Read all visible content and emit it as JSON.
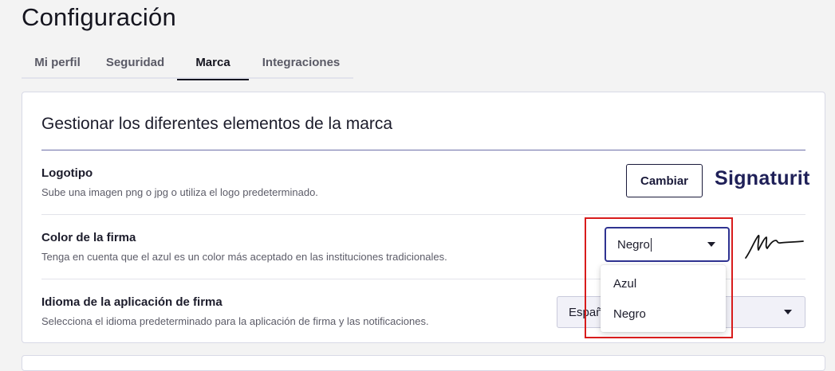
{
  "page": {
    "title": "Configuración"
  },
  "tabs": [
    {
      "label": "Mi perfil",
      "active": false
    },
    {
      "label": "Seguridad",
      "active": false
    },
    {
      "label": "Marca",
      "active": true
    },
    {
      "label": "Integraciones",
      "active": false
    }
  ],
  "card": {
    "title": "Gestionar los diferentes elementos de la marca",
    "logo_row": {
      "label": "Logotipo",
      "description": "Sube una imagen png o jpg o utiliza el logo predeterminado.",
      "button_label": "Cambiar",
      "brand_name": "Signaturit"
    },
    "color_row": {
      "label": "Color de la firma",
      "description": "Tenga en cuenta que el azul es un color más aceptado en las instituciones tradicionales.",
      "selected": "Negro",
      "options": [
        "Azul",
        "Negro"
      ]
    },
    "language_row": {
      "label": "Idioma de la aplicación de firma",
      "description": "Selecciona el idioma predeterminado para la aplicación de firma y las notificaciones.",
      "selected_partial": "Españ"
    }
  },
  "icons": {
    "select_caret": "caret-down-icon",
    "signature": "signature-icon"
  },
  "colors": {
    "accent": "#2f3391",
    "brand": "#1f2058",
    "highlight": "#d81c1c"
  }
}
